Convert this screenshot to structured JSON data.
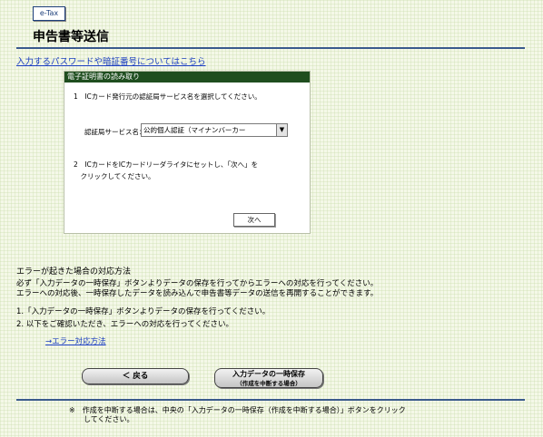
{
  "logo": {
    "text": "e-Tax"
  },
  "page_title": "申告書等送信",
  "password_link": "入力するパスワードや暗証番号についてはこちら",
  "cert_panel": {
    "header": "電子証明書の読み取り",
    "step1": "1　ICカード発行元の認証局サービス名を選択してください。",
    "service_label": "認証局サービス名：",
    "service_value": "公的個人認証（マイナンバーカー",
    "step2_line1": "2　ICカードをICカードリーダライタにセットし、「次へ」を",
    "step2_line2": "　クリックしてください。",
    "next_button": "次へ"
  },
  "error_section": {
    "heading": "エラーが起きた場合の対応方法",
    "para1_line1": "必ず「入力データの一時保存」ボタンよりデータの保存を行ってからエラーへの対応を行ってください。",
    "para1_line2": "エラーへの対応後、一時保存したデータを読み込んで申告書等データの送信を再開することができます。",
    "item1": "1.「入力データの一時保存」ボタンよりデータの保存を行ってください。",
    "item2": "2. 以下をご確認いただき、エラーへの対応を行ってください。",
    "link": "→エラー対応方法"
  },
  "buttons": {
    "back": "＜ 戻る",
    "save_line1": "入力データの一時保存",
    "save_line2": "（作成を中断する場合）"
  },
  "footer_note": {
    "line1": "※　作成を中断する場合は、中央の「入力データの一時保存（作成を中断する場合）」ボタンをクリック",
    "line2": "　　してください。"
  },
  "colors": {
    "header_green": "#1f4e1f",
    "rule_blue": "#3a5a8c",
    "link_blue": "#1b3ec0"
  }
}
